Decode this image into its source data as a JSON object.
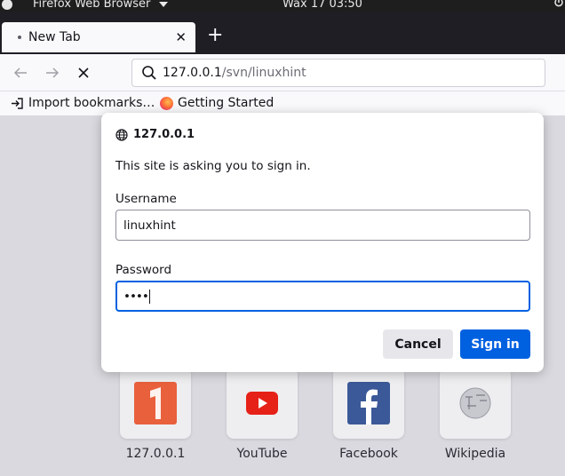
{
  "system_bar": {
    "app_name": "Firefox Web Browser",
    "clock": "Wax 17  03:50"
  },
  "tabs": [
    {
      "label": "New Tab"
    }
  ],
  "address_bar": {
    "host": "127.0.0.1",
    "path": "/svn/linuxhint"
  },
  "bookmarks": [
    {
      "label": "Import bookmarks…",
      "icon": "import-icon"
    },
    {
      "label": "Getting Started",
      "icon": "firefox-icon"
    }
  ],
  "top_sites": [
    {
      "label": "127.0.0.1",
      "icon": "generic-site-icon",
      "color": "#e8603c"
    },
    {
      "label": "YouTube",
      "icon": "youtube-icon",
      "color": "#e62117"
    },
    {
      "label": "Facebook",
      "icon": "facebook-icon",
      "color": "#3b5998"
    },
    {
      "label": "Wikipedia",
      "icon": "wikipedia-icon",
      "color": "#b0b0b8"
    }
  ],
  "auth_dialog": {
    "origin": "127.0.0.1",
    "message": "This site is asking you to sign in.",
    "username_label": "Username",
    "username_value": "linuxhint",
    "password_label": "Password",
    "password_value": "••••",
    "cancel_label": "Cancel",
    "signin_label": "Sign in"
  },
  "colors": {
    "accent": "#0061e0",
    "tab_strip": "#1f1e25",
    "system_bar": "#1e1e1e"
  }
}
